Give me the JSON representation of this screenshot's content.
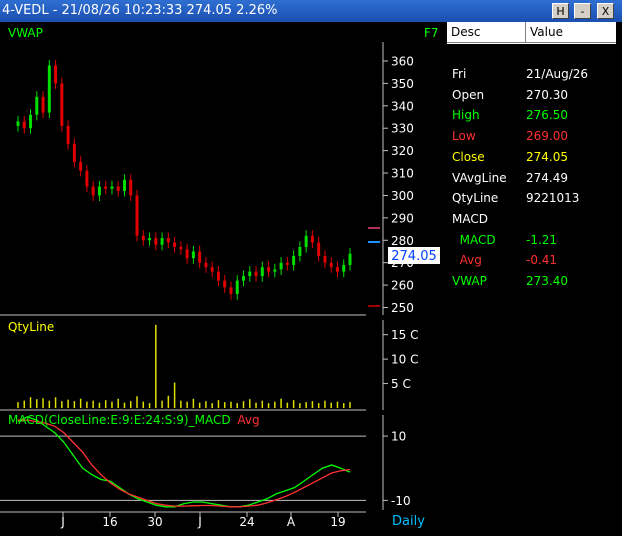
{
  "window": {
    "title": "4-VEDL - 21/08/26 10:23:33 274.05 2.26%",
    "buttons": [
      "H",
      "-",
      "X"
    ]
  },
  "chart_area": {
    "price_panel_label": "VWAP",
    "shortcut_label": "F7",
    "last_price_label": "274.05",
    "qty_panel_label": "QtyLine",
    "macd_label": "MACD(CloseLine:E:9:E:24:S:9)_MACD",
    "macd_avg_label": "Avg",
    "period_label": "Daily",
    "colors": {
      "up": "#00e000",
      "down": "#e00000",
      "qty": "#e0e000",
      "macd": "#00ff00",
      "avg": "#ff3030"
    }
  },
  "chart_data": [
    {
      "type": "candlestick",
      "panel": "price",
      "ylim": [
        248,
        364
      ],
      "y_ticks": [
        250,
        260,
        270,
        280,
        290,
        300,
        310,
        320,
        330,
        340,
        350,
        360
      ],
      "x_tick_labels": [
        "J",
        "16",
        "30",
        "J",
        "24",
        "A",
        "19"
      ],
      "close": [
        333,
        330,
        336,
        344,
        337,
        358,
        350,
        331,
        323,
        315,
        311,
        304,
        300,
        304,
        303,
        304,
        302,
        307,
        300,
        282,
        280,
        281,
        278,
        281,
        279,
        277,
        276,
        272,
        275,
        270,
        268,
        266,
        262,
        259,
        256,
        262,
        264,
        266,
        264,
        268,
        266,
        267,
        270,
        269,
        273,
        277,
        282,
        279,
        273,
        270,
        268,
        266,
        269,
        274
      ],
      "last": 274.05
    },
    {
      "type": "bar",
      "panel": "qty",
      "name": "QtyLine",
      "y_ticks": [
        5,
        10,
        15
      ],
      "y_tick_suffix": "C",
      "ylim": [
        0,
        18
      ],
      "values": [
        1.2,
        1.5,
        2.2,
        1.8,
        2.0,
        1.5,
        2.2,
        1.4,
        1.7,
        1.4,
        1.9,
        1.3,
        1.5,
        1.1,
        1.6,
        1.3,
        1.9,
        1.1,
        1.4,
        2.4,
        1.3,
        1.0,
        17.0,
        1.5,
        2.5,
        5.2,
        1.5,
        1.3,
        1.9,
        1.1,
        1.4,
        1.0,
        1.6,
        1.2,
        1.3,
        1.0,
        1.4,
        1.8,
        1.1,
        1.5,
        1.0,
        1.3,
        1.9,
        1.1,
        1.6,
        1.0,
        1.2,
        1.4,
        1.0,
        1.5,
        1.1,
        1.3,
        1.0,
        1.2
      ]
    },
    {
      "type": "line",
      "panel": "macd",
      "y_ticks": [
        10,
        -10
      ],
      "ylim": [
        -13,
        15
      ],
      "series": [
        {
          "name": "_MACD",
          "values": [
            14.5,
            16,
            15,
            13,
            11,
            8,
            4,
            0,
            -2,
            -3.5,
            -4,
            -6,
            -8,
            -9.5,
            -10.5,
            -11.5,
            -12,
            -12,
            -11,
            -10.5,
            -10.5,
            -11,
            -11.5,
            -12,
            -12,
            -11.5,
            -10.5,
            -9.5,
            -8,
            -7,
            -6,
            -4,
            -2,
            0,
            1,
            0,
            -1.2
          ]
        },
        {
          "name": "Avg",
          "values": [
            15,
            15,
            14.5,
            14,
            13,
            11,
            8,
            5,
            1,
            -2,
            -4.5,
            -6.5,
            -8,
            -9,
            -10,
            -11,
            -11.5,
            -11.8,
            -11.8,
            -11.7,
            -11.6,
            -11.6,
            -11.8,
            -12,
            -12,
            -11.8,
            -11.5,
            -10.8,
            -9.8,
            -8.8,
            -7.5,
            -6,
            -4.5,
            -3,
            -1.5,
            -0.8,
            -0.4
          ]
        }
      ]
    }
  ],
  "side_panel": {
    "header": {
      "desc": "Desc",
      "value": "Value"
    },
    "rows": [
      {
        "desc": "Fri",
        "value": "21/Aug/26",
        "color": "#ffffff"
      },
      {
        "desc": "Open",
        "value": "270.30",
        "color": "#ffffff"
      },
      {
        "desc": "High",
        "value": "276.50",
        "color": "#00ff00"
      },
      {
        "desc": "Low",
        "value": "269.00",
        "color": "#ff3030"
      },
      {
        "desc": "Close",
        "value": "274.05",
        "color": "#ffff00"
      },
      {
        "desc": "VAvgLine",
        "value": "274.49",
        "color": "#ffffff"
      },
      {
        "desc": "QtyLine",
        "value": "9221013",
        "color": "#ffffff"
      },
      {
        "desc": "MACD",
        "value": "",
        "color": "#ffffff"
      },
      {
        "desc": "  MACD",
        "value": "-1.21",
        "color": "#00ff00"
      },
      {
        "desc": "  Avg",
        "value": "-0.41",
        "color": "#ff3030"
      },
      {
        "desc": "VWAP",
        "value": "273.40",
        "color": "#00ff00"
      }
    ]
  }
}
